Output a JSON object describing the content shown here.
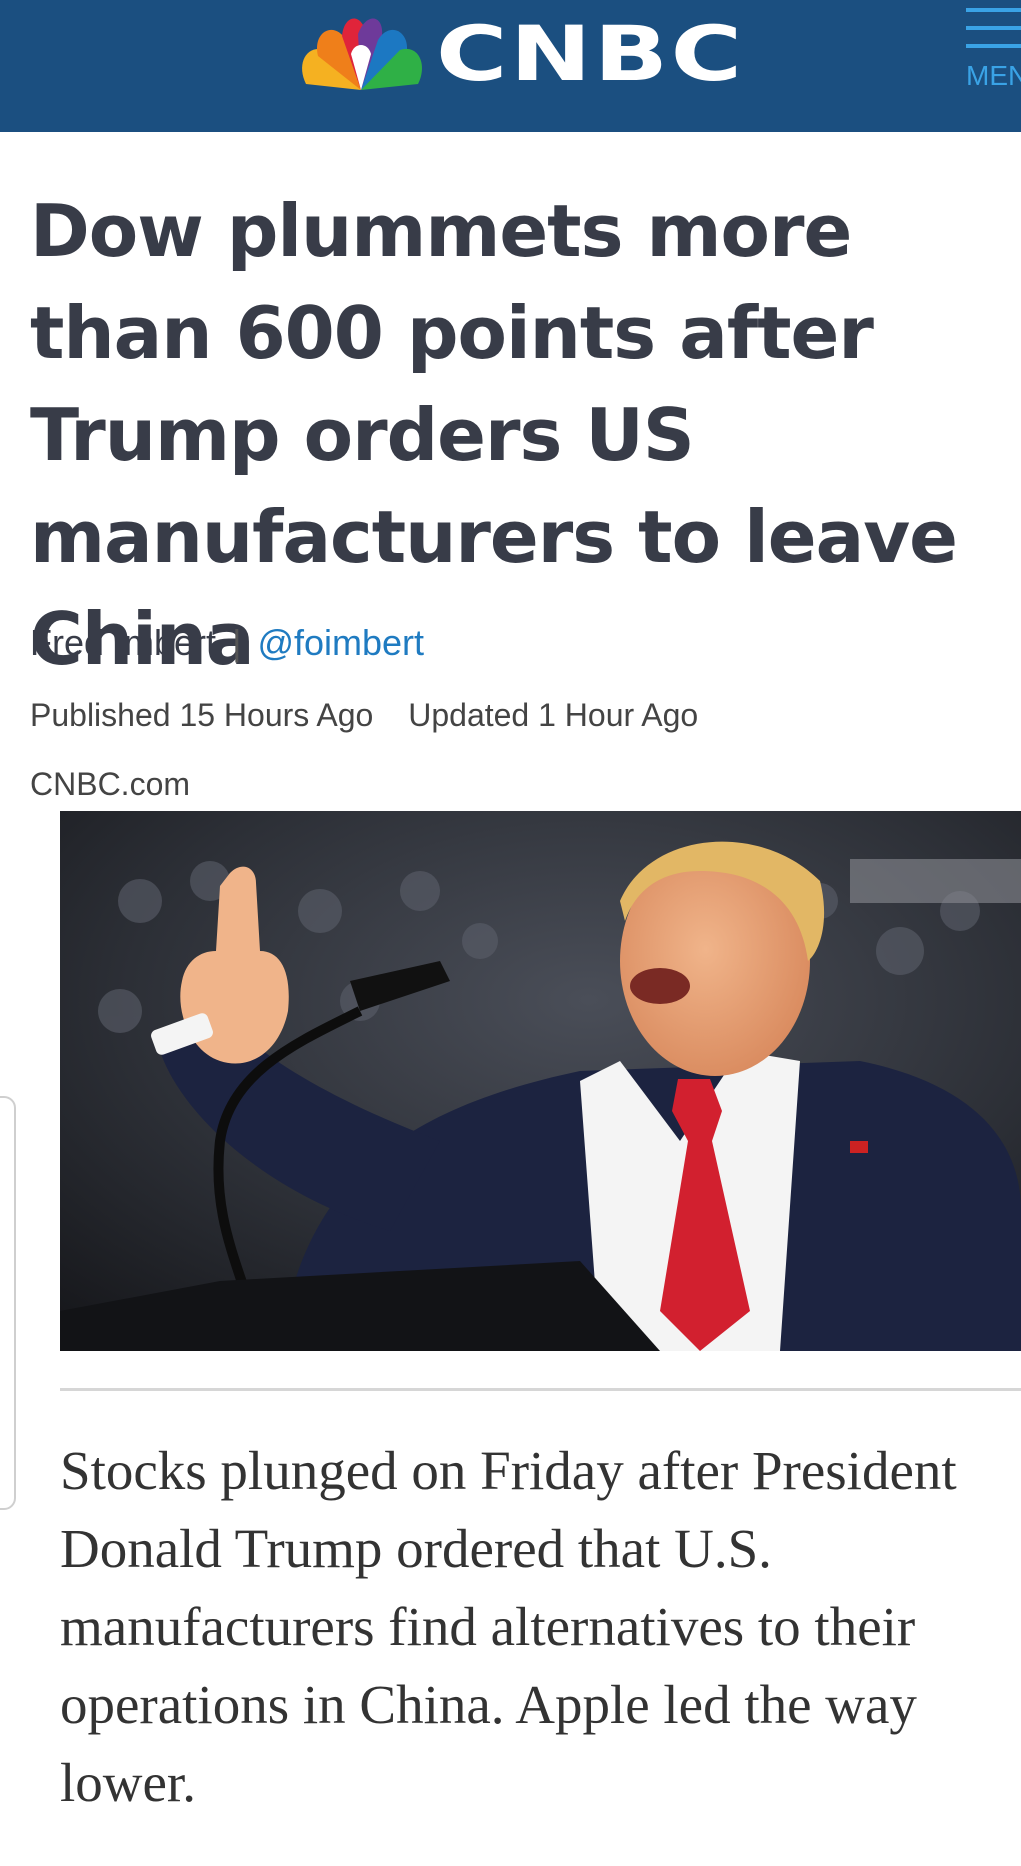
{
  "header": {
    "logo_text": "CNBC",
    "menu_label": "MENU",
    "background": "#1b4f80",
    "accent": "#3aa3e6"
  },
  "article": {
    "headline": "Dow plummets more than 600 points after Trump orders US manufacturers to leave China",
    "author": "Fred Imbert",
    "author_separator": "|",
    "author_handle": "@foimbert",
    "published": "Published 15 Hours Ago",
    "updated": "Updated 1 Hour Ago",
    "source": "CNBC.com",
    "summary": "Stocks plunged on Friday after President Donald Trump ordered that U.S. manufacturers find alternatives to their operations in China. Apple led the way lower."
  },
  "icons": {
    "logo": "peacock-icon",
    "menu": "hamburger-icon"
  },
  "colors": {
    "headline": "#383c48",
    "handle_link": "#1f7bc1"
  }
}
